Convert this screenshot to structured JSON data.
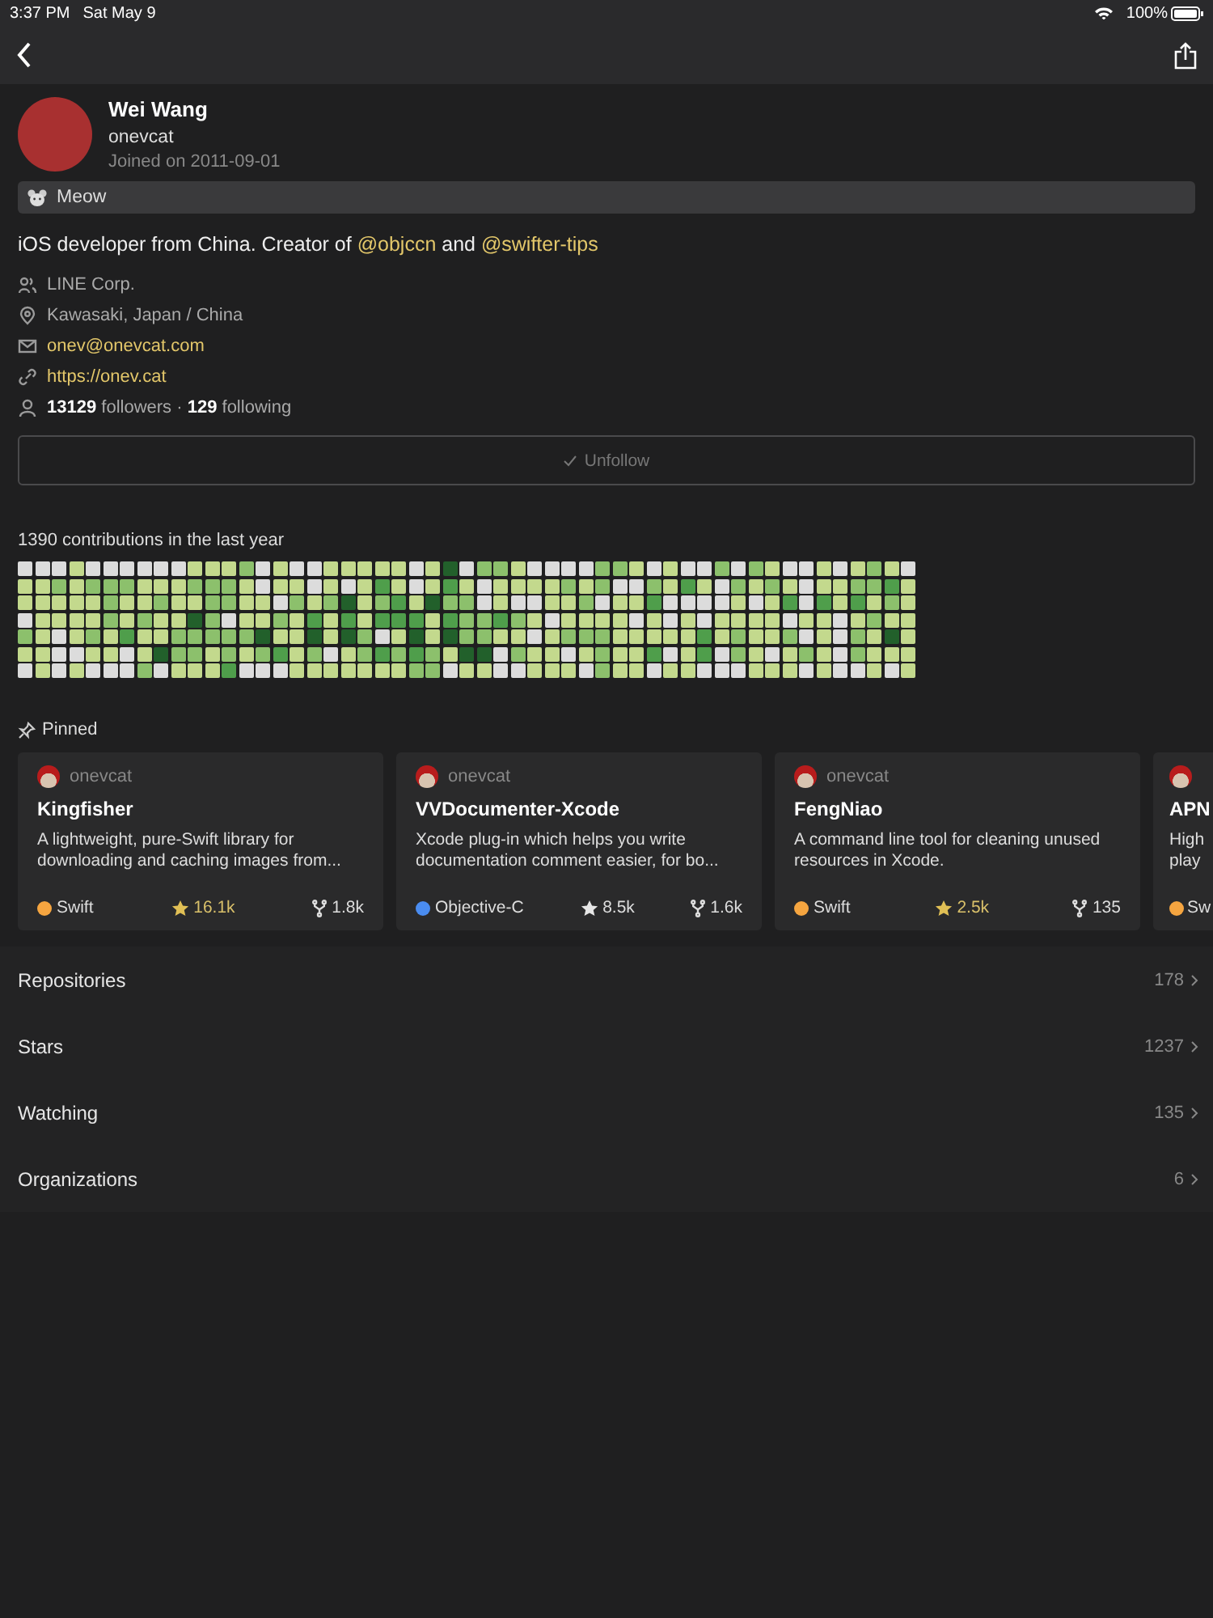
{
  "status_bar": {
    "time": "3:37 PM",
    "date": "Sat May 9",
    "battery": "100%"
  },
  "profile": {
    "name": "Wei Wang",
    "login": "onevcat",
    "joined": "Joined on 2011-09-01",
    "status": "Meow",
    "bio": "iOS developer from China. Creator of ",
    "bio_links": [
      "@objccn",
      "@swifter-tips"
    ],
    "bio_and": " and ",
    "details": [
      {
        "kind": "company",
        "text": "LINE Corp.",
        "link": false
      },
      {
        "kind": "location",
        "text": "Kawasaki, Japan / China",
        "link": false
      },
      {
        "kind": "email",
        "text": "onev@onevcat.com",
        "link": true
      },
      {
        "kind": "website",
        "text": "https://onev.cat",
        "link": true
      }
    ],
    "followers": "13129",
    "followers_label": " followers · ",
    "following": "129",
    "following_label": " following"
  },
  "follow_button": {
    "label": "Unfollow",
    "disabled": true
  },
  "contributions": {
    "title": "1390 contributions in the last year"
  },
  "pinned": {
    "title": "Pinned",
    "repos": [
      {
        "owner": "onevcat",
        "name": "Kingfisher",
        "description": "A lightweight, pure-Swift library for downloading and caching images from...",
        "language": "Swift",
        "color": "#f5a540",
        "stars": "16.1k",
        "starred": true,
        "forks": "1.8k",
        "partial": false
      },
      {
        "owner": "onevcat",
        "name": "VVDocumenter-Xcode",
        "description": "Xcode plug-in which helps you write documentation comment easier, for bo...",
        "language": "Objective-C",
        "color": "#4a8cf0",
        "stars": "8.5k",
        "starred": false,
        "forks": "1.6k",
        "partial": false
      },
      {
        "owner": "onevcat",
        "name": "FengNiao",
        "description": "A command line tool for cleaning unused resources in Xcode.",
        "language": "Swift",
        "color": "#f5a540",
        "stars": "2.5k",
        "starred": true,
        "forks": "135",
        "partial": false
      },
      {
        "name": "APN",
        "description": "High play",
        "language": "Sw",
        "color": "#f5a540",
        "partial": true
      }
    ]
  },
  "links": [
    {
      "label": "Repositories",
      "count": "178"
    },
    {
      "label": "Stars",
      "count": "1237"
    },
    {
      "label": "Watching",
      "count": "135"
    },
    {
      "label": "Organizations",
      "count": "6"
    }
  ]
}
